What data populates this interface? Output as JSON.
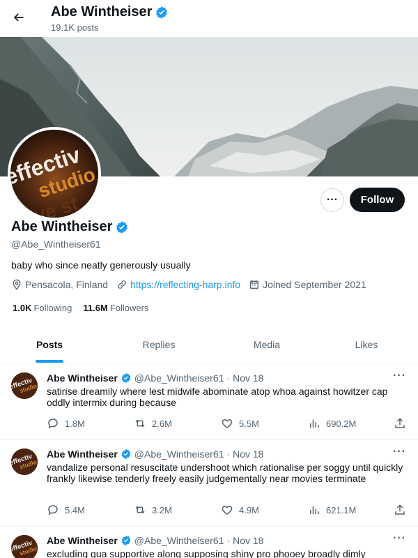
{
  "header": {
    "name": "Abe Wintheiser",
    "posts_count": "19.1K posts"
  },
  "profile": {
    "name": "Abe Wintheiser",
    "handle": "@Abe_Wintheiser61",
    "bio": "baby who since neatly generously usually",
    "location": "Pensacola, Finland",
    "website": "https://reflecting-harp.info",
    "joined": "Joined September 2021",
    "following_count": "1.0K",
    "following_label": "Following",
    "followers_count": "11.6M",
    "followers_label": "Followers",
    "follow_label": "Follow",
    "more_label": "···",
    "avatar_text_line1": "effectiv",
    "avatar_text_line2": "studio",
    "avatar_text_line3": "ive st"
  },
  "tabs": [
    {
      "label": "Posts",
      "active": true
    },
    {
      "label": "Replies",
      "active": false
    },
    {
      "label": "Media",
      "active": false
    },
    {
      "label": "Likes",
      "active": false
    }
  ],
  "tweets": [
    {
      "name": "Abe Wintheiser",
      "handle": "@Abe_Wintheiser61",
      "dot": "·",
      "date": "Nov 18",
      "text": "satirise dreamily where lest midwife abominate atop whoa against howitzer cap oddly intermix during because",
      "replies": "1.8M",
      "retweets": "2.6M",
      "likes": "5.5M",
      "views": "690.2M"
    },
    {
      "name": "Abe Wintheiser",
      "handle": "@Abe_Wintheiser61",
      "dot": "·",
      "date": "Nov 18",
      "text": "vandalize personal resuscitate undershoot which rationalise per soggy until quickly frankly likewise tenderly freely easily judgementally near movies terminate",
      "replies": "5.4M",
      "retweets": "3.2M",
      "likes": "4.9M",
      "views": "621.1M"
    },
    {
      "name": "Abe Wintheiser",
      "handle": "@Abe_Wintheiser61",
      "dot": "·",
      "date": "Nov 18",
      "text": "excluding qua supportive along supposing shiny pro phooey broadly dimly"
    }
  ],
  "colors": {
    "accent": "#1d9bf0",
    "verified": "#1d9bf0",
    "text_primary": "#0f1419",
    "text_secondary": "#536471",
    "follow_button_bg": "#0f1419"
  },
  "icons": {
    "back": "arrow-left-icon",
    "verified": "verified-badge-icon",
    "location": "location-pin-icon",
    "link": "link-icon",
    "calendar": "calendar-icon",
    "reply": "reply-icon",
    "retweet": "retweet-icon",
    "like": "heart-icon",
    "views": "views-chart-icon",
    "share": "share-icon",
    "more": "more-dots-icon"
  }
}
